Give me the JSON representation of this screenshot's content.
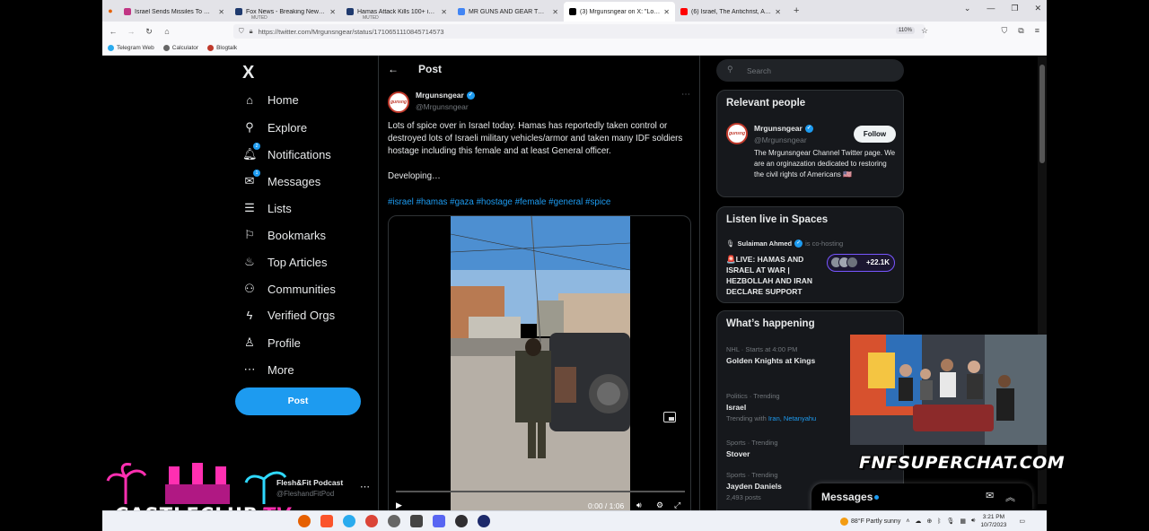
{
  "browser": {
    "tabs": [
      {
        "title": "Israel Sends Missiles To Gaza Aft",
        "sub": "",
        "color": "#c13584",
        "active": false
      },
      {
        "title": "Fox News - Breaking News Upd",
        "sub": "MUTED",
        "color": "#1f3a6e",
        "active": false
      },
      {
        "title": "Hamas Attack Kills 100+ in Israe",
        "sub": "MUTED",
        "color": "#1f3a6e",
        "active": false
      },
      {
        "title": "MR GUNS AND GEAR TWITTER",
        "sub": "",
        "color": "#4285f4",
        "active": false
      },
      {
        "title": "(3) Mrgunsngear on X: \"Lots of",
        "sub": "",
        "color": "#000000",
        "active": true
      },
      {
        "title": "(6) Israel, The Antichrist, AI, An",
        "sub": "",
        "color": "#ff0000",
        "active": false
      }
    ],
    "url": "https://twitter.com/Mrgunsngear/status/1710651110845714573",
    "zoom": "110%",
    "bookmarks": [
      {
        "label": "Telegram Web",
        "color": "#2aabee"
      },
      {
        "label": "Calculator",
        "color": "#666666"
      },
      {
        "label": "Blogtalk",
        "color": "#c0392b"
      }
    ]
  },
  "nav": {
    "logo": "X",
    "items": [
      {
        "label": "Home",
        "icon": "⌂",
        "badge": ""
      },
      {
        "label": "Explore",
        "icon": "⚲",
        "badge": ""
      },
      {
        "label": "Notifications",
        "icon": "🔔︎",
        "badge": "2"
      },
      {
        "label": "Messages",
        "icon": "✉",
        "badge": "1"
      },
      {
        "label": "Lists",
        "icon": "☰",
        "badge": ""
      },
      {
        "label": "Bookmarks",
        "icon": "⚐",
        "badge": ""
      },
      {
        "label": "Top Articles",
        "icon": "♨",
        "badge": ""
      },
      {
        "label": "Communities",
        "icon": "⚇",
        "badge": ""
      },
      {
        "label": "Verified Orgs",
        "icon": "ϟ",
        "badge": ""
      },
      {
        "label": "Profile",
        "icon": "♙",
        "badge": ""
      },
      {
        "label": "More",
        "icon": "⋯",
        "badge": ""
      }
    ],
    "post_button": "Post",
    "account": {
      "name": "Flesh&Fit Podcast",
      "handle": "@FleshandFitPod"
    }
  },
  "post": {
    "header": "Post",
    "author": "Mrgunsngear",
    "handle": "@Mrgunsngear",
    "avatar_text": "gunsng",
    "text": "Lots of spice over in Israel today.   Hamas has reportedly taken control or destroyed lots of Israeli military vehicles/armor and taken many IDF soldiers hostage including this female and at least General officer.",
    "text2": "Developing…",
    "hashtags": "#israel #hamas #gaza #hostage #female #general #spice",
    "video_time": "0:00 / 1:06",
    "video_progress": 0
  },
  "right": {
    "search_placeholder": "Search",
    "relevant": {
      "title": "Relevant people",
      "name": "Mrgunsngear",
      "handle": "@Mrgunsngear",
      "follow": "Follow",
      "bio": "The Mrgunsngear Channel Twitter page. We are an orginazation dedicated to restoring the civil rights of Americans 🇺🇸"
    },
    "spaces": {
      "title": "Listen live in Spaces",
      "host": "Sulaiman Ahmed",
      "cohost": "is co-hosting",
      "space_title": "🚨LIVE: HAMAS AND ISRAEL AT WAR | HEZBOLLAH AND IRAN DECLARE SUPPORT",
      "listeners": "+22.1K"
    },
    "happening": {
      "title": "What’s happening",
      "trends": [
        {
          "meta": "NHL · Starts at 4:00 PM",
          "name": "Golden Knights at Kings",
          "with": ""
        },
        {
          "meta": "Politics · Trending",
          "name": "Israel",
          "with": "Trending with"
        },
        {
          "meta": "Sports · Trending",
          "name": "Stover",
          "with": ""
        },
        {
          "meta": "Sports · Trending",
          "name": "Jayden Daniels",
          "with": "2,493 posts"
        }
      ],
      "trend2_links": "Iran, Netanyahu"
    },
    "messages": "Messages"
  },
  "overlay": {
    "superchat": "FNFSUPERCHAT.COM",
    "logo_text": "CASTLECLUB",
    "logo_tv": "TV"
  },
  "taskbar": {
    "weather": "88°F  Partly sunny",
    "time": "3:21 PM",
    "date": "10/7/2023"
  }
}
